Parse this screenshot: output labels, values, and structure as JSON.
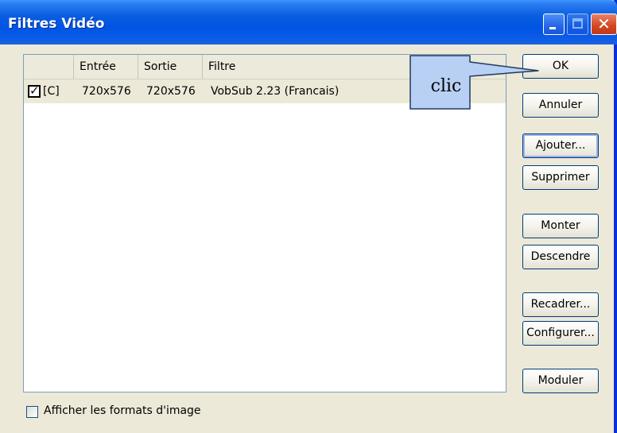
{
  "window": {
    "title": "Filtres Vidéo",
    "close_glyph": "✕"
  },
  "list": {
    "columns": [
      "",
      "Entrée",
      "Sortie",
      "Filtre"
    ],
    "rows": [
      {
        "checked": true,
        "flag": "[C]",
        "input": "720x576",
        "output": "720x576",
        "filter": "VobSub 2.23 (Francais)"
      }
    ]
  },
  "buttons": {
    "ok": "OK",
    "cancel": "Annuler",
    "add": "Ajouter...",
    "delete": "Supprimer",
    "up": "Monter",
    "down": "Descendre",
    "crop": "Recadrer...",
    "configure": "Configurer...",
    "blend": "Moduler"
  },
  "options": {
    "show_formats_label": "Afficher les formats d'image",
    "show_formats_checked": false
  },
  "annotation": {
    "callout_text": "clic",
    "callout_fill": "#b8d0f4"
  },
  "colors": {
    "titlebar": "#0054e3",
    "dialog_bg": "#ece9d8"
  }
}
